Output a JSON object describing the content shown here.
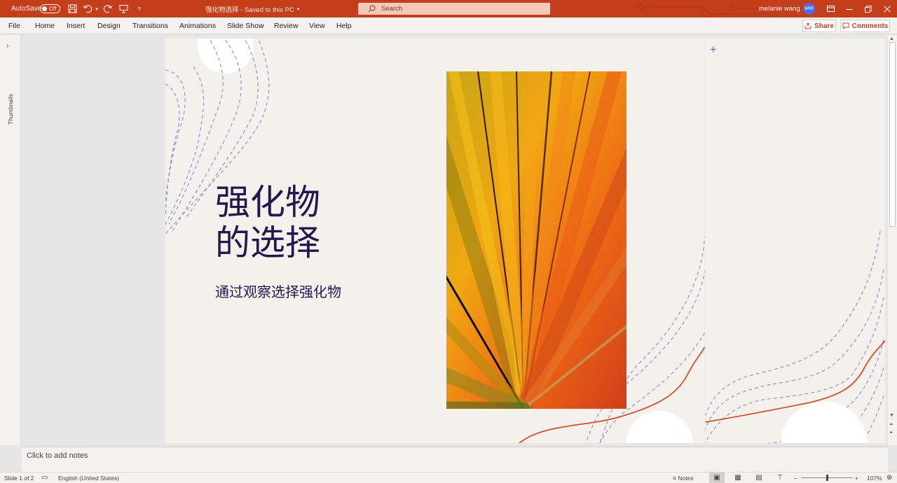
{
  "titlebar": {
    "autosave_label": "AutoSave",
    "autosave_state": "Off",
    "doc_title": "强化物选择  -  Saved to this PC",
    "search_placeholder": "Search",
    "user_name": "melanie wang",
    "user_initials": "MW",
    "accent_color": "#c43e1c"
  },
  "ribbon": {
    "tabs": [
      "File",
      "Home",
      "Insert",
      "Design",
      "Transitions",
      "Animations",
      "Slide Show",
      "Review",
      "View",
      "Help"
    ],
    "share_label": "Share",
    "comments_label": "Comments"
  },
  "thumbnails": {
    "label": "Thumbnails"
  },
  "slide": {
    "title_line1": "强化物",
    "title_line2": "的选择",
    "subtitle": "通过观察选择强化物",
    "plus_marker": "+"
  },
  "notes": {
    "placeholder": "Click to add notes"
  },
  "statusbar": {
    "slide_indicator": "Slide 1 of 2",
    "language": "English (United States)",
    "notes_label": "Notes",
    "zoom_level": "107%",
    "zoom_minus": "–",
    "zoom_plus": "+"
  },
  "icons": [
    "save-icon",
    "undo-icon",
    "redo-icon",
    "present-icon",
    "customize-icon",
    "search-icon",
    "ribbon-display-icon",
    "minimize-icon",
    "restore-icon",
    "close-icon",
    "share-icon",
    "comment-icon",
    "accessibility-icon",
    "normal-view-icon",
    "slide-sorter-icon",
    "reading-view-icon",
    "slideshow-icon",
    "fit-slide-icon"
  ]
}
